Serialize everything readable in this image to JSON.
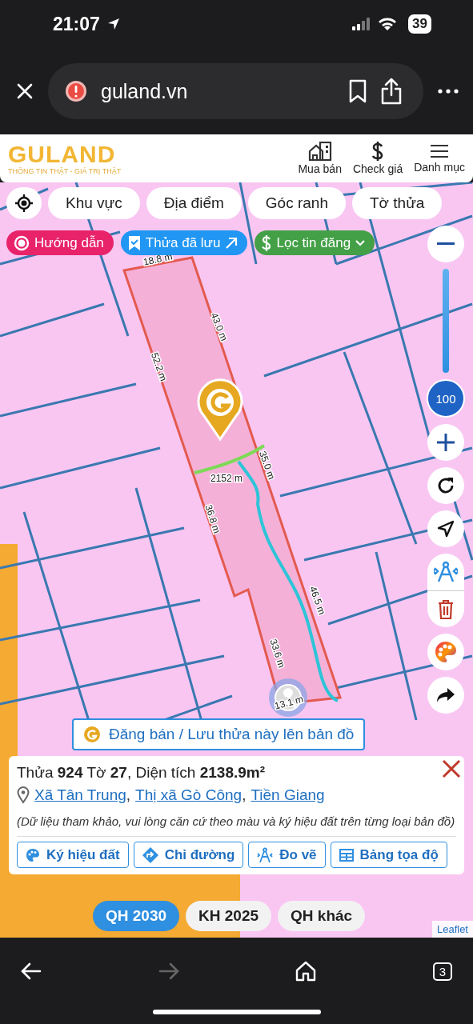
{
  "status_bar": {
    "time": "21:07",
    "battery": "39"
  },
  "browser": {
    "url": "guland.vn",
    "tab_count": "3"
  },
  "header": {
    "logo": "GULAND",
    "tagline": "THÔNG TIN THẬT - GIÁ TRỊ THẬT",
    "nav": [
      {
        "label": "Mua bán",
        "kind": "building"
      },
      {
        "label": "Check giá",
        "kind": "dollar"
      },
      {
        "label": "Danh mục",
        "kind": "menu"
      }
    ]
  },
  "map_tabs": [
    "Khu vực",
    "Địa điểm",
    "Góc ranh",
    "Tờ thửa"
  ],
  "chips": [
    {
      "label": "Hướng dẫn",
      "kind": "guide",
      "color": "#e8236a"
    },
    {
      "label": "Thửa đã lưu",
      "kind": "saved",
      "color": "#2196f3"
    },
    {
      "label": "Lọc tin đăng",
      "kind": "filter",
      "color": "#43a047"
    }
  ],
  "opacity_slider": {
    "level": 1,
    "reading": "100"
  },
  "measurements": [
    "18.8 m",
    "43.0 m",
    "52.2 m",
    "35.0 m",
    "2152 m",
    "36.8 m",
    "46.5 m",
    "33.6 m",
    "13.1 m"
  ],
  "save_banner": "Đăng bán / Lưu thửa này lên bản đồ",
  "parcel": {
    "title": "Thửa **924** Tờ **27**, Diện tích **2138.9m²**",
    "location": [
      "Xã Tân Trung",
      "Thị xã Gò Công",
      "Tiền Giang"
    ],
    "separator": ",",
    "note": "(Dữ liệu tham khảo, vui lòng căn cứ theo màu và ký hiệu đất trên từng loại bản đồ)",
    "actions": [
      {
        "label": "Ký hiệu đất",
        "kind": "palette"
      },
      {
        "label": "Chỉ đường",
        "kind": "directions"
      },
      {
        "label": "Đo vẽ",
        "kind": "measure"
      },
      {
        "label": "Bảng tọa độ",
        "kind": "table"
      }
    ]
  },
  "plan_layers": [
    {
      "label": "QH 2030",
      "selected": true
    },
    {
      "label": "KH 2025",
      "selected": false
    },
    {
      "label": "QH khác",
      "selected": false
    }
  ],
  "attribution": "Leaflet"
}
